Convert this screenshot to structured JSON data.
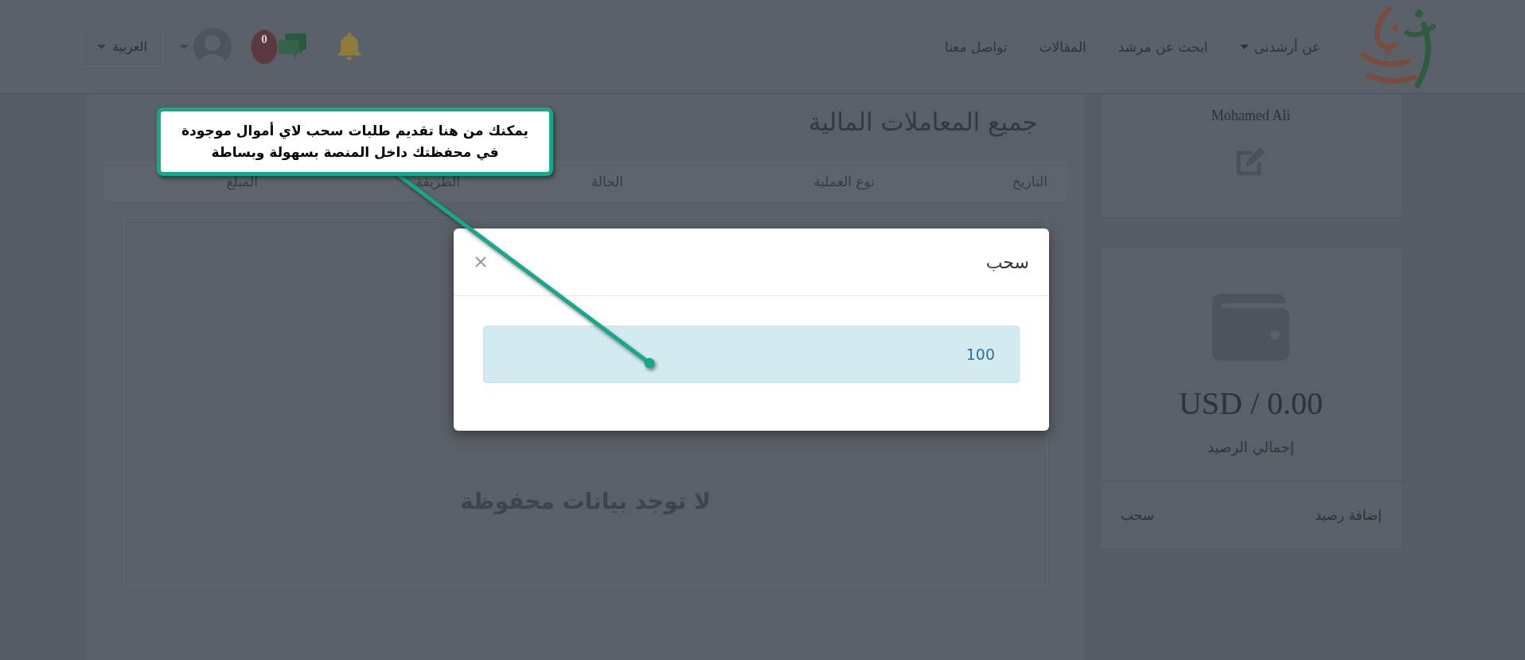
{
  "header": {
    "nav": [
      {
        "label": "عن أرشدنى",
        "dropdown": true
      },
      {
        "label": "ابحث عن مرشد",
        "dropdown": false
      },
      {
        "label": "المقالات",
        "dropdown": false
      },
      {
        "label": "تواصل معنا",
        "dropdown": false
      }
    ],
    "messages_badge": "0",
    "language": "العربية"
  },
  "callout": {
    "text": "يمكنك من هنا تقديم طلبات سحب لاي أموال موجودة في محفظتك داخل المنصة بسهولة وبساطة"
  },
  "page": {
    "title": "جميع المعاملات المالية",
    "table": {
      "columns": [
        "التاريخ",
        "نوع العملية",
        "الحالة",
        "الطريقة",
        "المبلغ"
      ],
      "empty_message": "لا توجد بيانات محفوظة"
    }
  },
  "sidebar": {
    "profile": {
      "name": "Mohamed Ali"
    },
    "wallet": {
      "balance": "USD / 0.00",
      "balance_label": "إجمالي الرصيد",
      "actions": [
        {
          "label": "إضافة رصيد"
        },
        {
          "label": "سحب"
        }
      ]
    }
  },
  "modal": {
    "title": "سحب",
    "amount_field": {
      "value": "100"
    }
  }
}
